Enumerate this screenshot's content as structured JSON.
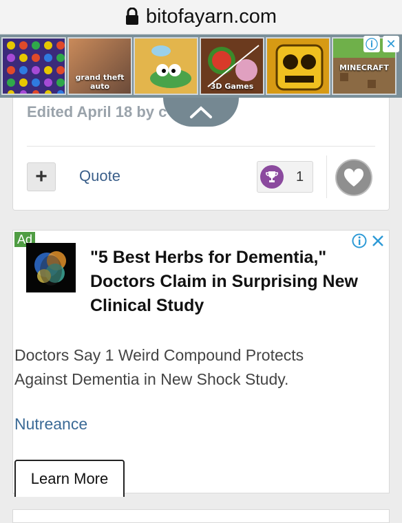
{
  "browser": {
    "url": "bitofayarn.com"
  },
  "game_banner": {
    "tiles": [
      {
        "name": "candy-crush",
        "label": ""
      },
      {
        "name": "grand-theft-auto",
        "label": "grand theft auto"
      },
      {
        "name": "wheres-my-water",
        "label": ""
      },
      {
        "name": "fruit-ninja",
        "label": "3D Games"
      },
      {
        "name": "temple-run",
        "label": ""
      },
      {
        "name": "minecraft",
        "label": "MINECRAFT"
      }
    ]
  },
  "post": {
    "edited_text": "Edited April 18 by c",
    "quote_label": "Quote",
    "plus_label": "+",
    "reaction_count": "1"
  },
  "ad": {
    "badge": "Ad",
    "headline": "\"5 Best Herbs for Dementia,\" Doctors Claim in Surprising New Clinical Study",
    "body": "Doctors Say 1 Weird Compound Protects Against Dementia in New Shock Study.",
    "sponsor": "Nutreance",
    "cta": "Learn More"
  },
  "colors": {
    "accent_blue": "#3b5f8a",
    "ad_green": "#4f9d43",
    "adchoice_blue": "#2d9ad6",
    "trophy_purple": "#8b4a9e"
  }
}
